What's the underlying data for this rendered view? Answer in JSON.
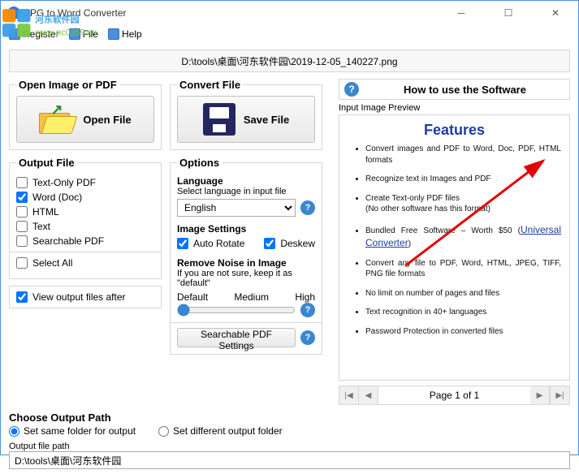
{
  "window": {
    "title": "JPG to Word Converter"
  },
  "watermark": {
    "line1": "河东软件园",
    "line2": "www.pc0359.cn"
  },
  "menubar": {
    "register": "Register",
    "file": "File",
    "help": "Help"
  },
  "pathbar": "D:\\tools\\桌面\\河东软件园\\2019-12-05_140227.png",
  "open": {
    "legend": "Open Image or PDF",
    "btn": "Open File"
  },
  "convert": {
    "legend": "Convert File",
    "btn": "Save File"
  },
  "help": {
    "text": "How to use the Software"
  },
  "preview": {
    "label": "Input Image Preview",
    "title": "Features",
    "items": [
      "Convert images and PDF to Word, Doc, PDF, HTML formats",
      "Recognize text in Images and PDF",
      "Create Text-only PDF files (No other software has this format)",
      "Bundled Free Software – Worth $50 (Universal Converter)",
      "Convert any file to PDF, Word, HTML, JPEG, TIFF, PNG file formats",
      "No limit on number of pages and files",
      "Text recognition in 40+ languages",
      "Password Protection in converted files"
    ],
    "link": "Universal Converter",
    "page": "Page 1 of 1"
  },
  "output": {
    "legend": "Output File",
    "items": [
      "Text-Only PDF",
      "Word (Doc)",
      "HTML",
      "Text",
      "Searchable PDF"
    ],
    "checked": [
      false,
      true,
      false,
      false,
      false
    ],
    "selectall": "Select All"
  },
  "view": "View output files after",
  "options": {
    "legend": "Options",
    "lang_label": "Language",
    "lang_sub": "Select language in input file",
    "lang_value": "English",
    "img_label": "Image Settings",
    "auto": "Auto Rotate",
    "deskew": "Deskew",
    "noise_label": "Remove Noise in Image",
    "noise_sub": "If you are not sure, keep it as \"default\"",
    "s_low": "Default",
    "s_mid": "Medium",
    "s_high": "High",
    "spdf_btn": "Searchable PDF Settings"
  },
  "choose": {
    "legend": "Choose Output Path",
    "same": "Set same folder for output",
    "diff": "Set different output folder"
  },
  "outpath": {
    "label": "Output file path",
    "value": "D:\\tools\\桌面\\河东软件园"
  }
}
